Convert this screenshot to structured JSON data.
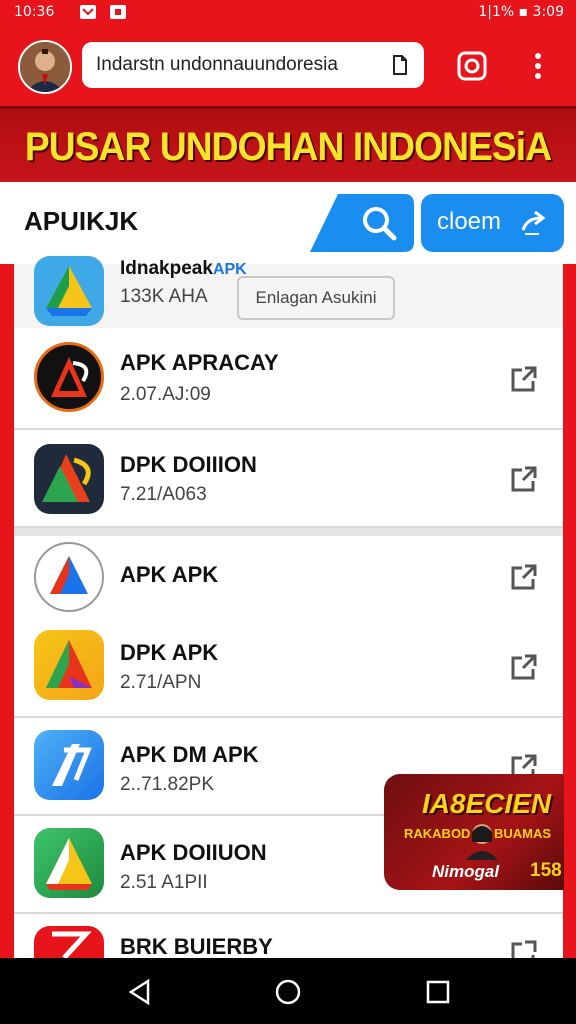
{
  "status": {
    "time": "10:36",
    "right": "1|1% ▪ 3:09"
  },
  "browser": {
    "url": "Indarstn undonnauundoresia"
  },
  "banner": {
    "title": "PUSAR UNDOHAN INDONESiA"
  },
  "header": {
    "title": "APUIKJK",
    "open_label": "cloem"
  },
  "tooltip": "Enlagan Asukini",
  "apps": [
    {
      "name": "Idnakpeak",
      "name_suffix": "APK",
      "version": "133K AHA"
    },
    {
      "name": "APK APRACAY",
      "version": "2.07.AJ:09"
    },
    {
      "name": "DPK DOIIION",
      "version": "7.21/A063"
    },
    {
      "name": "APK APK",
      "version": ""
    },
    {
      "name": "DPK APK",
      "version": "2.71/APN"
    },
    {
      "name": "APK DM APK",
      "version": "2..71.82PK"
    },
    {
      "name": "APK DOIIUON",
      "version": "2.51 A1PII"
    },
    {
      "name": "BRK BUIERBY",
      "version": ""
    }
  ],
  "promo": {
    "title": "IA8ECIEN",
    "sub_left": "RAKABOD",
    "sub_right": "BUAMAS",
    "label": "Nimogal",
    "number": "158"
  },
  "colors": {
    "brand_red": "#e8141b",
    "accent_blue": "#1a8ef0",
    "banner_yellow": "#f5e52a"
  }
}
